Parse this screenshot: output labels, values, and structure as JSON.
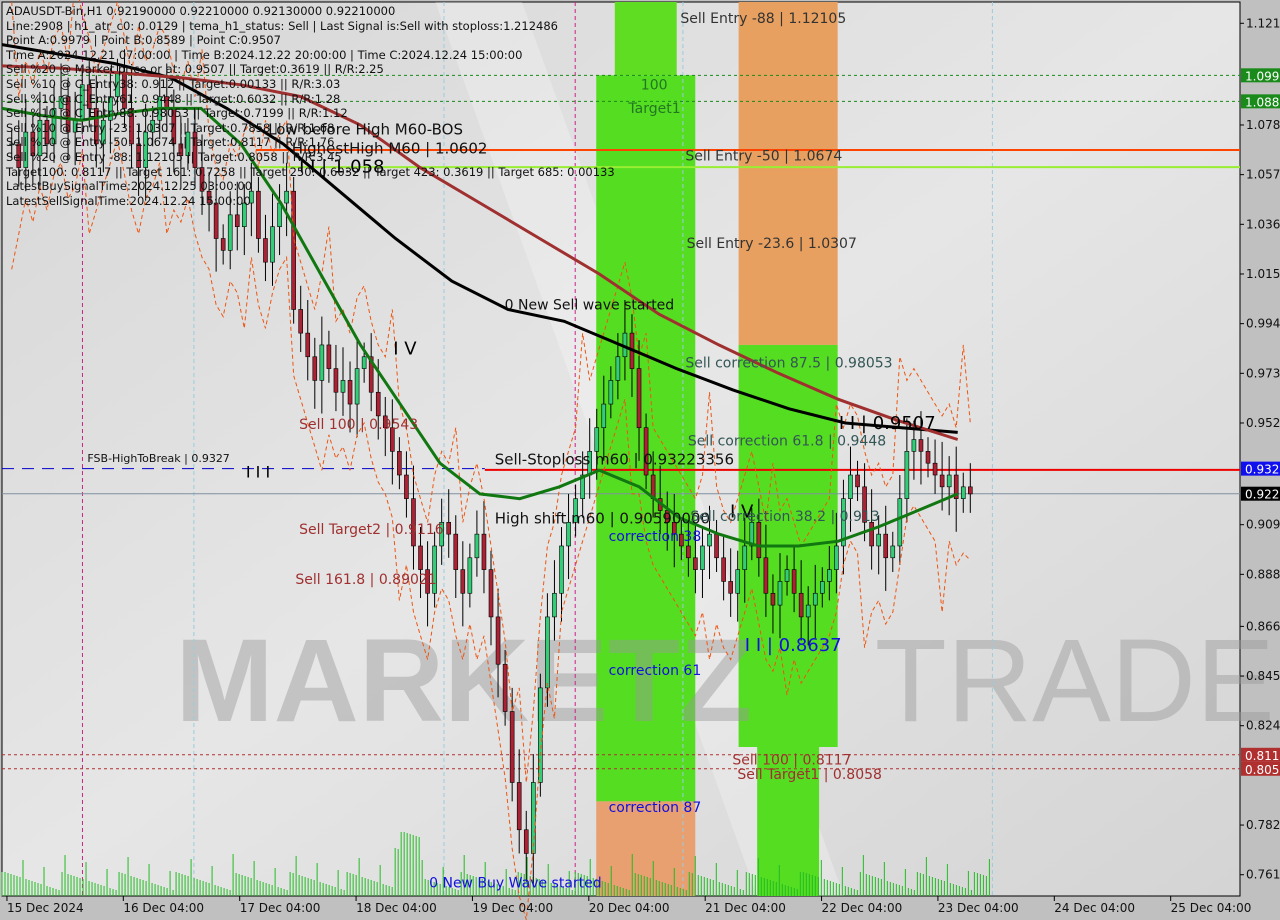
{
  "window": {
    "symbol_line": "ADAUSDT-Bin,H1  0.92190000 0.92210000 0.92130000 0.92210000"
  },
  "info_lines": [
    "Line:2908 | h1_atr_c0: 0.0129 | tema_h1_status: Sell | Last Signal is:Sell with stoploss:1.212486",
    "Point A:0.9979 | Point B:0.8589 | Point C:0.9507",
    "Time A:2024.12.21 07:00:00 | Time B:2024.12.22 20:00:00 | Time C:2024.12.24 15:00:00",
    "Sell %20 @ Market price or at: 0.9507 || Target:0.3619 || R/R:2.25",
    "Sell %10 @ C_Entry38: 0.912 || Target:0.00133 || R/R:3.03",
    "Sell %10 @ C_Entry61: 0.9448 || Target:0.6032 || R/R:1.28",
    "Sell %10 @ C_Entry88: 0.98053 || Target:0.7199 || R/R:1.12",
    "Sell %10 @ Entry -23: 1.0307 || Target:0.7858 || R/R:1.68",
    "Sell %10 @ Entry -50: 1.0674 || Target:0.8117 || R/R:1.76",
    "Sell %20 @ Entry -88: 1.12105 || Target:0.8058 || R/R:3.45",
    "Target100: 0.8117 || Target 161: 0.7258 || Target 250: 0.6032 || Target 423: 0.3619 || Target 685: 0.00133",
    "LatestBuySignalTime:2024.12.25 03:00:00",
    "LatestSellSignalTime:2024.12.24 15:00:00"
  ],
  "watermark": {
    "left": "MARKETZ",
    "right": "TRADE"
  },
  "chart_data": {
    "type": "candlestick",
    "title": "ADAUSDT-Bin,H1",
    "ylim": [
      0.752,
      1.13
    ],
    "y_ticks": [
      1.121,
      1.078,
      1.057,
      1.036,
      1.015,
      0.994,
      0.973,
      0.952,
      0.909,
      0.888,
      0.866,
      0.845,
      0.824,
      0.782,
      0.761
    ],
    "x_ticks": [
      "15 Dec 2024",
      "16 Dec 04:00",
      "17 Dec 04:00",
      "18 Dec 04:00",
      "19 Dec 04:00",
      "20 Dec 04:00",
      "21 Dec 04:00",
      "22 Dec 04:00",
      "23 Dec 04:00",
      "24 Dec 04:00",
      "25 Dec 04:00"
    ],
    "price_tags": [
      {
        "label": "1.099",
        "value": 1.099,
        "color": "#1a8a1a"
      },
      {
        "label": "1.088",
        "value": 1.088,
        "color": "#1a8a1a"
      },
      {
        "label": "0.932",
        "value": 0.9327,
        "color": "#1010ee"
      },
      {
        "label": "0.922",
        "value": 0.9221,
        "color": "#000000"
      },
      {
        "label": "0.811",
        "value": 0.8117,
        "color": "#b03030"
      },
      {
        "label": "0.805",
        "value": 0.8058,
        "color": "#b03030"
      }
    ],
    "close_series": [
      1.07,
      1.06,
      1.075,
      1.065,
      1.08,
      1.07,
      1.085,
      1.09,
      1.075,
      1.08,
      1.095,
      1.085,
      1.07,
      1.08,
      1.09,
      1.1,
      1.085,
      1.07,
      1.06,
      1.075,
      1.08,
      1.09,
      1.085,
      1.07,
      1.065,
      1.075,
      1.06,
      1.05,
      1.045,
      1.03,
      1.025,
      1.04,
      1.035,
      1.045,
      1.05,
      1.03,
      1.02,
      1.035,
      1.045,
      1.05,
      1.0,
      0.99,
      0.98,
      0.97,
      0.985,
      0.975,
      0.965,
      0.97,
      0.96,
      0.975,
      0.98,
      0.965,
      0.955,
      0.95,
      0.94,
      0.93,
      0.92,
      0.9,
      0.89,
      0.88,
      0.9,
      0.91,
      0.905,
      0.89,
      0.88,
      0.895,
      0.905,
      0.89,
      0.87,
      0.85,
      0.83,
      0.8,
      0.78,
      0.77,
      0.8,
      0.84,
      0.87,
      0.88,
      0.9,
      0.91,
      0.92,
      0.93,
      0.94,
      0.95,
      0.96,
      0.97,
      0.98,
      0.99,
      0.975,
      0.95,
      0.93,
      0.92,
      0.915,
      0.91,
      0.905,
      0.9,
      0.895,
      0.89,
      0.9,
      0.905,
      0.895,
      0.885,
      0.88,
      0.89,
      0.9,
      0.91,
      0.895,
      0.88,
      0.875,
      0.885,
      0.89,
      0.88,
      0.87,
      0.875,
      0.88,
      0.885,
      0.89,
      0.9,
      0.92,
      0.93,
      0.925,
      0.91,
      0.9,
      0.905,
      0.895,
      0.9,
      0.92,
      0.94,
      0.945,
      0.94,
      0.935,
      0.93,
      0.925,
      0.93,
      0.92,
      0.925,
      0.922
    ],
    "moving_averages": [
      {
        "name": "MA black",
        "color": "#000000",
        "values": [
          1.112,
          1.108,
          1.104,
          1.098,
          1.085,
          1.07,
          1.05,
          1.03,
          1.012,
          1.0,
          0.995,
          0.985,
          0.975,
          0.966,
          0.958,
          0.952,
          0.95,
          0.948
        ]
      },
      {
        "name": "MA brown",
        "color": "#a03030",
        "values": [
          1.103,
          1.102,
          1.1,
          1.098,
          1.095,
          1.09,
          1.078,
          1.06,
          1.045,
          1.03,
          1.015,
          0.998,
          0.985,
          0.973,
          0.962,
          0.953,
          0.945
        ]
      },
      {
        "name": "MA green",
        "color": "#117711",
        "values": [
          1.085,
          1.082,
          1.08,
          1.083,
          1.085,
          1.085,
          1.07,
          1.045,
          1.015,
          0.985,
          0.96,
          0.935,
          0.922,
          0.92,
          0.925,
          0.932,
          0.925,
          0.912,
          0.905,
          0.9,
          0.9,
          0.902,
          0.908,
          0.915,
          0.922
        ]
      }
    ],
    "horizontal_levels": [
      {
        "name": "sell-entry-88-level",
        "value": 1.099,
        "color": "#1a8a1a",
        "style": "dotted"
      },
      {
        "name": "target1-level",
        "value": 1.088,
        "color": "#1a8a1a",
        "style": "dotted"
      },
      {
        "name": "highest-high-level",
        "value": 1.0674,
        "color": "#ff4400",
        "style": "solid"
      },
      {
        "name": "sell-entry-50-level",
        "value": 1.0602,
        "color": "#99ee33",
        "style": "solid"
      },
      {
        "name": "fsb-high-to-break-level",
        "value": 0.9327,
        "color": "#0000cc",
        "style": "dashed"
      },
      {
        "name": "sell-stoploss-level",
        "value": 0.9322,
        "color": "#ee0000",
        "style": "solid"
      },
      {
        "name": "current-price-level",
        "value": 0.9221,
        "color": "#8090a0",
        "style": "solid"
      },
      {
        "name": "sell-100-level",
        "value": 0.8117,
        "color": "#b03030",
        "style": "dotted"
      },
      {
        "name": "sell-target1-level",
        "value": 0.8058,
        "color": "#b03030",
        "style": "dotted"
      }
    ],
    "zones": [
      {
        "name": "green-zone-top",
        "color": "#5fdd22",
        "x0": 0.495,
        "x1": 0.545,
        "y0": 1.13,
        "y1": 1.099
      },
      {
        "name": "green-zone-main",
        "color": "#55dd22",
        "x0": 0.48,
        "x1": 0.56,
        "y0": 1.099,
        "y1": 0.792
      },
      {
        "name": "orange-zone-bottom",
        "color": "#e8a070",
        "x0": 0.48,
        "x1": 0.56,
        "y0": 0.792,
        "y1": 0.752
      },
      {
        "name": "orange-zone-top",
        "color": "#e8a060",
        "x0": 0.595,
        "x1": 0.675,
        "y0": 1.13,
        "y1": 0.985
      },
      {
        "name": "green-zone-right",
        "color": "#55dd22",
        "x0": 0.595,
        "x1": 0.675,
        "y0": 0.985,
        "y1": 0.815
      },
      {
        "name": "green-zone-right-bottom",
        "color": "#55dd22",
        "x0": 0.61,
        "x1": 0.66,
        "y0": 0.815,
        "y1": 0.752
      }
    ],
    "annotations": [
      {
        "text": "Sell Entry -88 | 1.12105",
        "value": 1.12105,
        "xf": 0.548,
        "color": "#333333"
      },
      {
        "text": "100",
        "value": 1.093,
        "xf": 0.516,
        "color": "#227722"
      },
      {
        "text": "Target1",
        "value": 1.083,
        "xf": 0.506,
        "color": "#227722"
      },
      {
        "text": "Sell Entry -50 | 1.0674",
        "value": 1.063,
        "xf": 0.552,
        "color": "#333333"
      },
      {
        "text": "Low before High    M60-BOS",
        "value": 1.074,
        "xf": 0.215,
        "color": "#111111",
        "size": 15
      },
      {
        "text": "HighestHigh    M60 | 1.0602",
        "value": 1.066,
        "xf": 0.234,
        "color": "#111111",
        "size": 15
      },
      {
        "text": "I I | 1.058",
        "value": 1.058,
        "xf": 0.24,
        "color": "#000000",
        "size": 18
      },
      {
        "text": "Sell Entry -23.6 | 1.0307",
        "value": 1.026,
        "xf": 0.553,
        "color": "#333333"
      },
      {
        "text": "0 New Sell wave started",
        "value": 1.0,
        "xf": 0.406,
        "color": "#111111"
      },
      {
        "text": "I V",
        "value": 0.981,
        "xf": 0.316,
        "color": "#000000",
        "size": 18
      },
      {
        "text": "Sell correction 87.5 | 0.98053",
        "value": 0.9755,
        "xf": 0.552,
        "color": "#335555"
      },
      {
        "text": "Sell 100 | 0.9543",
        "value": 0.9495,
        "xf": 0.24,
        "color": "#a03030"
      },
      {
        "text": "I I | 0.9507",
        "value": 0.9495,
        "xf": 0.676,
        "color": "#000000",
        "size": 18
      },
      {
        "text": "Sell correction 61.8 | 0.9448",
        "value": 0.9425,
        "xf": 0.554,
        "color": "#335555"
      },
      {
        "text": "FSB-HighToBreak | 0.9327",
        "value": 0.9355,
        "xf": 0.069,
        "color": "#111111",
        "size": 11
      },
      {
        "text": "Sell-Stoploss m60 | 0.93223356",
        "value": 0.9345,
        "xf": 0.398,
        "color": "#111111",
        "size": 15
      },
      {
        "text": "I I I",
        "value": 0.929,
        "xf": 0.197,
        "color": "#000000",
        "size": 16
      },
      {
        "text": "High shift m60 | 0.90590000",
        "value": 0.9095,
        "xf": 0.398,
        "color": "#111111",
        "size": 15
      },
      {
        "text": "I V",
        "value": 0.912,
        "xf": 0.588,
        "color": "#000000",
        "size": 18
      },
      {
        "text": "Sell correction 38.2 | 0.913",
        "value": 0.9105,
        "xf": 0.556,
        "color": "#335555"
      },
      {
        "text": "correction 38",
        "value": 0.902,
        "xf": 0.49,
        "color": "#1010dd"
      },
      {
        "text": "Sell Target2 | 0.9116",
        "value": 0.905,
        "xf": 0.24,
        "color": "#a03030"
      },
      {
        "text": "Sell 161.8 | 0.89021",
        "value": 0.884,
        "xf": 0.237,
        "color": "#a03030"
      },
      {
        "text": "I I | 0.8637",
        "value": 0.8555,
        "xf": 0.6,
        "color": "#1010dd",
        "size": 18
      },
      {
        "text": "correction 61",
        "value": 0.8455,
        "xf": 0.49,
        "color": "#1010dd"
      },
      {
        "text": "Sell 100 | 0.8117",
        "value": 0.8075,
        "xf": 0.59,
        "color": "#a03030"
      },
      {
        "text": "Sell Target1 | 0.8058",
        "value": 0.8015,
        "xf": 0.594,
        "color": "#a03030"
      },
      {
        "text": "correction 87",
        "value": 0.7875,
        "xf": 0.49,
        "color": "#1010dd"
      },
      {
        "text": "0 New Buy Wave started",
        "value": 0.7555,
        "xf": 0.345,
        "color": "#1010dd"
      }
    ]
  }
}
